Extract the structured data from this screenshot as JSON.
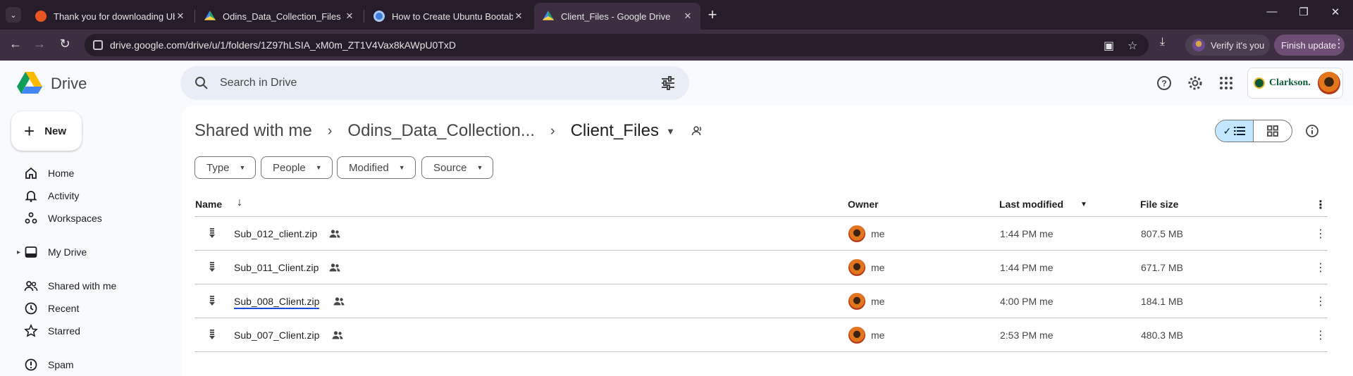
{
  "browser": {
    "tabs": [
      {
        "title": "Thank you for downloading Ub",
        "favicon": "ubuntu-favicon"
      },
      {
        "title": "Odins_Data_Collection_Files - G",
        "favicon": "drive-favicon"
      },
      {
        "title": "How to Create Ubuntu Bootabl",
        "favicon": "blog-favicon"
      },
      {
        "title": "Client_Files - Google Drive",
        "favicon": "drive-favicon"
      }
    ],
    "active_tab": 3,
    "url": "drive.google.com/drive/u/1/folders/1Z97hLSIA_xM0m_ZT1V4Vax8kAWpU0TxD",
    "verify_label": "Verify it's you",
    "finish_update_label": "Finish update"
  },
  "drive": {
    "app_name": "Drive",
    "search_placeholder": "Search in Drive",
    "org_name": "Clarkson.",
    "new_label": "New"
  },
  "sidebar": {
    "items": [
      {
        "label": "Home",
        "icon": "home-icon"
      },
      {
        "label": "Activity",
        "icon": "bell-icon"
      },
      {
        "label": "Workspaces",
        "icon": "workspaces-icon"
      },
      {
        "label": "My Drive",
        "icon": "my-drive-icon"
      },
      {
        "label": "Shared with me",
        "icon": "people-icon"
      },
      {
        "label": "Recent",
        "icon": "clock-icon"
      },
      {
        "label": "Starred",
        "icon": "star-icon"
      },
      {
        "label": "Spam",
        "icon": "alert-icon"
      }
    ]
  },
  "breadcrumb": {
    "root": "Shared with me",
    "parent": "Odins_Data_Collection...",
    "current": "Client_Files"
  },
  "filters": [
    "Type",
    "People",
    "Modified",
    "Source"
  ],
  "table": {
    "columns": {
      "name": "Name",
      "owner": "Owner",
      "modified": "Last modified",
      "size": "File size"
    },
    "rows": [
      {
        "name": "Sub_012_client.zip",
        "owner": "me",
        "modified": "1:44 PM me",
        "size": "807.5 MB"
      },
      {
        "name": "Sub_011_Client.zip",
        "owner": "me",
        "modified": "1:44 PM me",
        "size": "671.7 MB"
      },
      {
        "name": "Sub_008_Client.zip",
        "owner": "me",
        "modified": "4:00 PM me",
        "size": "184.1 MB"
      },
      {
        "name": "Sub_007_Client.zip",
        "owner": "me",
        "modified": "2:53 PM me",
        "size": "480.3 MB"
      }
    ]
  },
  "colors": {
    "chrome_frame": "#271d2a",
    "chrome_toolbar": "#3d2f41",
    "drive_bg": "#f8fafd",
    "accent_selected": "#c2e7ff",
    "annotation_ink": "#1a4be0"
  }
}
